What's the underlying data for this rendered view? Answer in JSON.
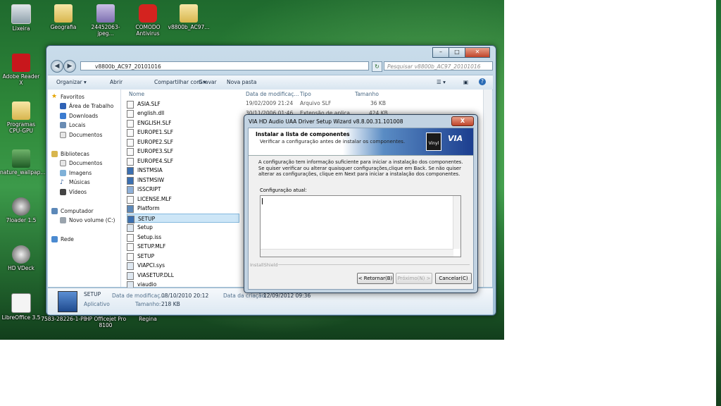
{
  "desktop": {
    "icons": [
      {
        "label": "Lixeira"
      },
      {
        "label": "Geografia"
      },
      {
        "label": "24452063-jpeg..."
      },
      {
        "label": "COMODO Antivirus"
      },
      {
        "label": "v8800b_AC97..."
      },
      {
        "label": "Adobe Reader X"
      },
      {
        "label": "Programas CPU-GPU"
      },
      {
        "label": "nature_wallpap..."
      },
      {
        "label": "7loader 1.5"
      },
      {
        "label": "HD VDeck"
      },
      {
        "label": "LibreOffice 3.5"
      },
      {
        "label": "7583-28226-1-PB"
      },
      {
        "label": "HP Officejet Pro 8100"
      },
      {
        "label": "Regina"
      }
    ]
  },
  "explorer": {
    "address": "v8800b_AC97_20101016",
    "search_placeholder": "Pesquisar v8800b_AC97_20101016",
    "toolbar": {
      "organize": "Organizar ▾",
      "open": "Abrir",
      "share": "Compartilhar com ▾",
      "burn": "Gravar",
      "new_folder": "Nova pasta"
    },
    "nav": {
      "favorites": "Favoritos",
      "desktop": "Área de Trabalho",
      "downloads": "Downloads",
      "places": "Locais",
      "documents": "Documentos",
      "libraries": "Bibliotecas",
      "lib_documents": "Documentos",
      "images": "Imagens",
      "music": "Músicas",
      "videos": "Vídeos",
      "computer": "Computador",
      "volume": "Novo volume (C:)",
      "network": "Rede"
    },
    "columns": {
      "name": "Nome",
      "date": "Data de modificaç...",
      "type": "Tipo",
      "size": "Tamanho"
    },
    "files": [
      {
        "name": "ASIA.SLF"
      },
      {
        "name": "english.dll"
      },
      {
        "name": "ENGLISH.SLF"
      },
      {
        "name": "EUROPE1.SLF"
      },
      {
        "name": "EUROPE2.SLF"
      },
      {
        "name": "EUROPE3.SLF"
      },
      {
        "name": "EUROPE4.SLF"
      },
      {
        "name": "INSTMSIA"
      },
      {
        "name": "INSTMSIW"
      },
      {
        "name": "ISSCRIPT"
      },
      {
        "name": "LICENSE.MLF"
      },
      {
        "name": "Platform"
      },
      {
        "name": "SETUP"
      },
      {
        "name": "Setup"
      },
      {
        "name": "Setup.iss"
      },
      {
        "name": "SETUP.MLF"
      },
      {
        "name": "SETUP"
      },
      {
        "name": "VIAPCI.sys"
      },
      {
        "name": "VIASETUP.DLL"
      },
      {
        "name": "viaudio"
      }
    ],
    "row0": {
      "date": "19/02/2009 21:24",
      "type": "Arquivo SLF",
      "size": "36 KB"
    },
    "row1": {
      "date": "30/11/2006 01:46",
      "type": "Extensão de aplica...",
      "size": "424 KB"
    },
    "details": {
      "name": "SETUP",
      "kind": "Aplicativo",
      "modified_label": "Data de modificaç...",
      "modified": "08/10/2010 20:12",
      "size_label": "Tamanho:",
      "size": "218 KB",
      "created_label": "Data da criação:",
      "created": "12/09/2012 09:36"
    }
  },
  "dialog": {
    "title": "VIA HD Audio UAA Driver Setup Wizard v8.8.00.31.101008",
    "close": "X",
    "banner_title": "Instalar a lista de componentes",
    "banner_subtitle": "Verificar a configuração antes de instalar os componentes.",
    "vinyl": "Vinyl",
    "via": "VIA",
    "description": "A configuração tem informação suficiente para iniciar a instalação dos componentes. Se quiser verificar ou alterar quaisquer configurações,clique em Back. Se não quiser alterar as configurações, clique em Next para iniciar a instalação dos componentes.",
    "config_label": "Configuração atual:",
    "installshield": "InstallShield",
    "back": "< Retornar(B)",
    "next": "Próximo(N) >",
    "cancel": "Cancelar(C)"
  }
}
